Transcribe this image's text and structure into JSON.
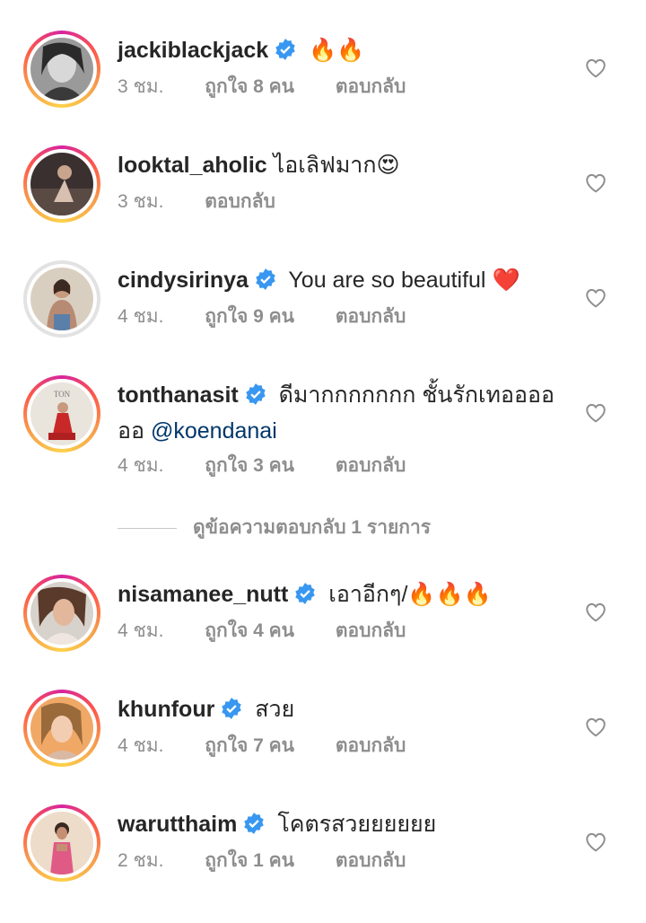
{
  "comments": [
    {
      "username": "jackiblackjack",
      "verified": true,
      "text": "",
      "emoji": "🔥🔥",
      "time": "3 ชม.",
      "likes": "ถูกใจ 8 คน",
      "reply": "ตอบกลับ",
      "ring": true
    },
    {
      "username": "looktal_aholic",
      "verified": false,
      "text": "ไอเลิฟมาก",
      "emoji": "😍",
      "time": "3 ชม.",
      "likes": "",
      "reply": "ตอบกลับ",
      "ring": true
    },
    {
      "username": "cindysirinya",
      "verified": true,
      "text": "You are so beautiful",
      "emoji": "❤️",
      "time": "4 ชม.",
      "likes": "ถูกใจ 9 คน",
      "reply": "ตอบกลับ",
      "ring": false
    },
    {
      "username": "tonthanasit",
      "verified": true,
      "text": "ดีมากกกกกกก ชั้นรักเทออออออ",
      "mention": "@koendanai",
      "emoji": "",
      "time": "4 ชม.",
      "likes": "ถูกใจ 3 คน",
      "reply": "ตอบกลับ",
      "ring": true
    },
    {
      "username": "nisamanee_nutt",
      "verified": true,
      "text": "เอาอีกๆ/",
      "emoji": "🔥🔥🔥",
      "time": "4 ชม.",
      "likes": "ถูกใจ 4 คน",
      "reply": "ตอบกลับ",
      "ring": true
    },
    {
      "username": "khunfour",
      "verified": true,
      "text": "สวย",
      "emoji": "",
      "time": "4 ชม.",
      "likes": "ถูกใจ 7 คน",
      "reply": "ตอบกลับ",
      "ring": true
    },
    {
      "username": "warutthaim",
      "verified": true,
      "text": "โคตรสวยยยยยย",
      "emoji": "",
      "time": "2 ชม.",
      "likes": "ถูกใจ 1 คน",
      "reply": "ตอบกลับ",
      "ring": true
    }
  ],
  "view_replies_label": "ดูข้อความตอบกลับ 1 รายการ",
  "colors": {
    "verified": "#3897f0",
    "secondary_text": "#8e8e8e",
    "mention": "#00376b"
  },
  "icons": {
    "like": "heart-outline-icon",
    "verified": "verified-badge-icon"
  }
}
